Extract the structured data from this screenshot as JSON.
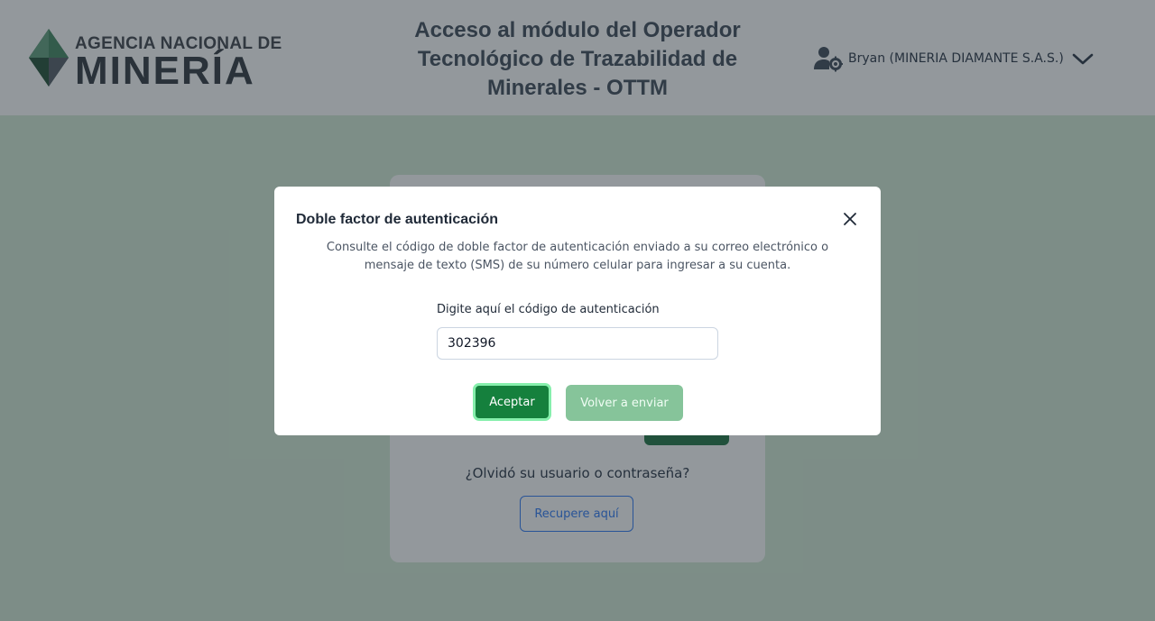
{
  "header": {
    "logo_line1": "AGENCIA NACIONAL DE",
    "logo_line2": "MINERÍA",
    "title": "Acceso al módulo del Operador Tecnológico de Trazabilidad de Minerales - OTTM",
    "user_name": "Bryan (MINERIA DIAMANTE S.A.S.)",
    "user_icon": "user-settings-icon",
    "dropdown_icon": "chevron-down-icon"
  },
  "login_card": {
    "forgot_text": "¿Olvidó su usuario o contraseña?",
    "recover_label": "Recupere aquí"
  },
  "modal": {
    "title": "Doble factor de autenticación",
    "description": "Consulte el código de doble factor de autenticación enviado a su correo electrónico o mensaje de texto (SMS) de su número celular para ingresar a su cuenta.",
    "field_label": "Digite aquí el código de autenticación",
    "code_value": "302396",
    "accept_label": "Aceptar",
    "resend_label": "Volver a enviar",
    "close_icon": "close-icon"
  },
  "colors": {
    "page_bg": "#d6ecd8",
    "primary_green": "#15803d",
    "disabled_green": "#86c49a",
    "link_blue": "#3b82f6"
  }
}
